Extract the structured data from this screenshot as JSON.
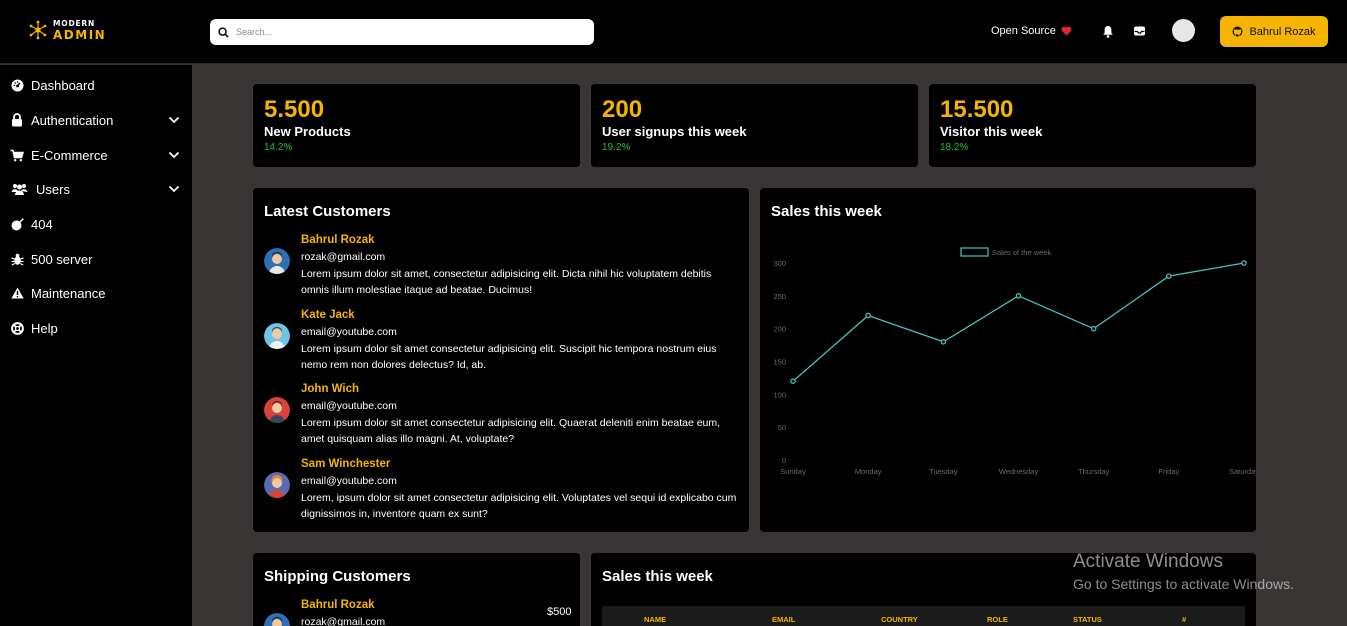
{
  "app": {
    "logo_line1": "MODERN",
    "logo_line2": "ADMIN"
  },
  "topbar": {
    "search_placeholder": "Search...",
    "open_source_label": "Open Source",
    "github_button_label": "Bahrul Rozak"
  },
  "sidebar": {
    "items": [
      {
        "label": "Dashboard",
        "icon": "dashboard-icon"
      },
      {
        "label": "Authentication",
        "icon": "lock-icon"
      },
      {
        "label": "E-Commerce",
        "icon": "cart-icon"
      },
      {
        "label": "Users",
        "icon": "users-icon"
      },
      {
        "label": "404",
        "icon": "bomb-icon"
      },
      {
        "label": "500 server",
        "icon": "bug-icon"
      },
      {
        "label": "Maintenance",
        "icon": "warning-icon"
      },
      {
        "label": "Help",
        "icon": "lifebuoy-icon"
      }
    ]
  },
  "stats": [
    {
      "value": "5.500",
      "label": "New Products",
      "delta": "14.2%"
    },
    {
      "value": "200",
      "label": "User signups this week",
      "delta": "19.2%"
    },
    {
      "value": "15.500",
      "label": "Visitor this week",
      "delta": "18.2%"
    }
  ],
  "latest_customers": {
    "title": "Latest Customers",
    "items": [
      {
        "name": "Bahrul Rozak",
        "email": "rozak@gmail.com",
        "message": "Lorem ipsum dolor sit amet, consectetur adipisicing elit. Dicta nihil hic voluptatem debitis omnis illum molestiae itaque ad beatae. Ducimus!"
      },
      {
        "name": "Kate Jack",
        "email": "email@youtube.com",
        "message": "Lorem ipsum dolor sit amet consectetur adipisicing elit. Suscipit hic tempora nostrum eius nemo rem non dolores delectus? Id, ab."
      },
      {
        "name": "John Wich",
        "email": "email@youtube.com",
        "message": "Lorem ipsum dolor sit amet consectetur adipisicing elit. Quaerat deleniti enim beatae eum, amet quisquam alias illo magni. At, voluptate?"
      },
      {
        "name": "Sam Winchester",
        "email": "email@youtube.com",
        "message": "Lorem, ipsum dolor sit amet consectetur adipisicing elit. Voluptates vel sequi id explicabo cum dignissimos in, inventore quam ex sunt?"
      }
    ]
  },
  "sales_chart": {
    "title": "Sales this week"
  },
  "chart_data": {
    "type": "line",
    "categories": [
      "Sunday",
      "Monday",
      "Tuesday",
      "Wednesday",
      "Thursday",
      "Friday",
      "Saturday"
    ],
    "series": [
      {
        "name": "Sales of the week",
        "values": [
          120,
          220,
          180,
          250,
          200,
          280,
          300
        ]
      }
    ],
    "yticks": [
      0,
      50,
      100,
      150,
      200,
      250,
      300
    ],
    "ylim": [
      0,
      300
    ],
    "legend": "top-center",
    "color": "#4bc0c0"
  },
  "shipping_customers": {
    "title": "Shipping Customers",
    "items": [
      {
        "name": "Bahrul Rozak",
        "email": "rozak@gmail.com",
        "price": "$500"
      }
    ]
  },
  "sales_table": {
    "title": "Sales this week",
    "columns": [
      "NAME",
      "EMAIL",
      "COUNTRY",
      "ROLE",
      "STATUS",
      "#"
    ]
  },
  "watermark": {
    "line1": "Activate Windows",
    "line2": "Go to Settings to activate Windows."
  },
  "colors": {
    "accent": "#f5b400",
    "positive": "#1ec337",
    "chart_line": "#4bc0c0",
    "heart": "#e0262e"
  }
}
